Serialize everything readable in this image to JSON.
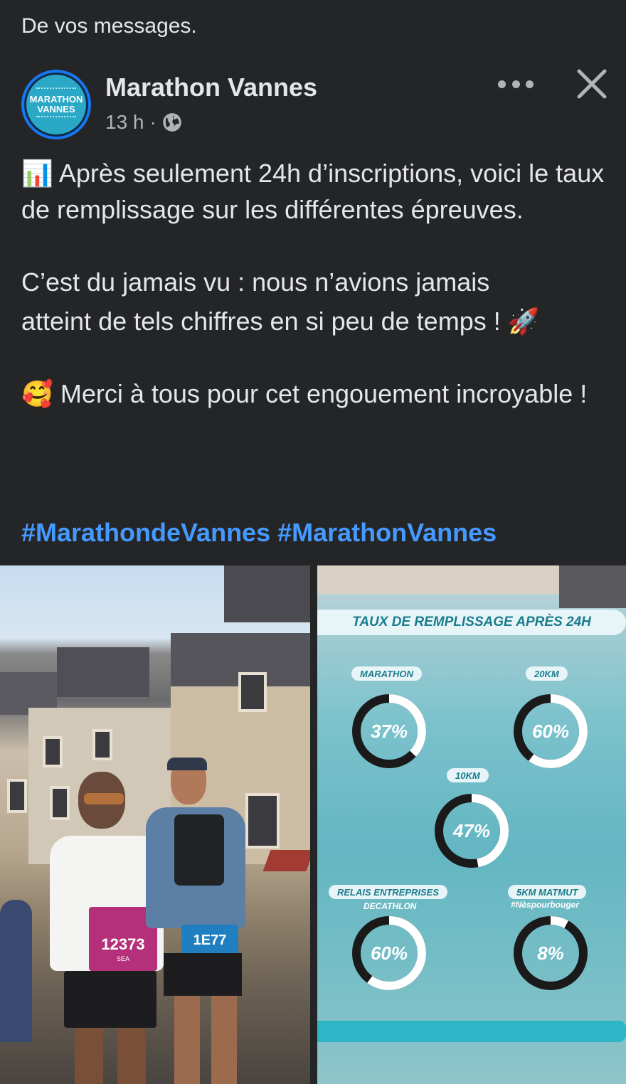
{
  "hint": "De vos messages.",
  "post": {
    "page_name": "Marathon Vannes",
    "avatar_text_1": "MARATHON",
    "avatar_text_2": "VANNES",
    "time": "13 h",
    "dot": "·",
    "para1": "📊 Après seulement 24h d’inscriptions, voici le taux de remplissage sur les différentes épreuves.",
    "para2_line1": "C’est du jamais vu : nous n’avions jamais",
    "para2_line2": "atteint de tels chiffres en si peu de temps ! 🚀",
    "para3": "🥰 Merci à tous pour cet engouement incroyable !",
    "hashtags": "#MarathondeVannes #MarathonVannes"
  },
  "photo_left": {
    "bib_1": "12373",
    "bib_1_sub": "SEA",
    "bib_2": "1E77"
  },
  "infographic": {
    "title": "TAUX DE REMPLISSAGE APRÈS 24H",
    "items": [
      {
        "label": "MARATHON",
        "sub": "",
        "percent_text": "37%",
        "fill": 0.37
      },
      {
        "label": "20KM",
        "sub": "",
        "percent_text": "60%",
        "fill": 0.6
      },
      {
        "label": "10KM",
        "sub": "",
        "percent_text": "47%",
        "fill": 0.47
      },
      {
        "label": "RELAIS ENTREPRISES",
        "sub": "DECATHLON",
        "percent_text": "60%",
        "fill": 0.6
      },
      {
        "label": "5KM MATMUT",
        "sub": "#Nèspourbouger",
        "percent_text": "8%",
        "fill": 0.08
      }
    ]
  },
  "colors": {
    "bg": "#242526",
    "text": "#e4e6eb",
    "secondary": "#b0b3b8",
    "hashtag": "#4599ff",
    "avatar_ring": "#1877f2",
    "gauge_track": "#1a1a1a",
    "gauge_fill": "#ffffff"
  }
}
